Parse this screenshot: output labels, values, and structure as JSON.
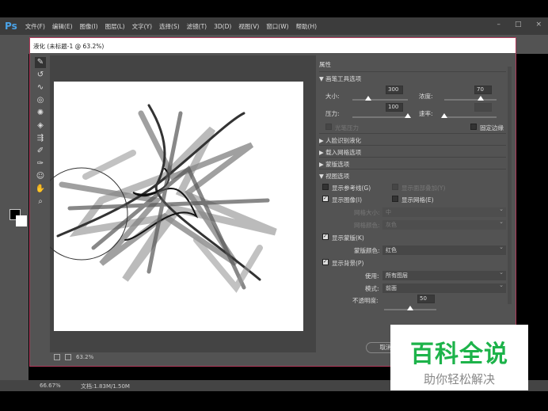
{
  "app": {
    "logo": "Ps",
    "menus": [
      "文件(F)",
      "编辑(E)",
      "图像(I)",
      "图层(L)",
      "文字(Y)",
      "选择(S)",
      "滤镜(T)",
      "3D(D)",
      "视图(V)",
      "窗口(W)",
      "帮助(H)"
    ],
    "window_controls": [
      "–",
      "□",
      "×"
    ]
  },
  "status": {
    "zoom": "66.67%",
    "doc": "文档:1.83M/1.50M"
  },
  "dialog": {
    "title": "液化 (未标题-1 @ 63.2%)",
    "zoom": "63.2%",
    "cancel_label": "取消"
  },
  "panel": {
    "title": "属性",
    "brush_section": "画笔工具选项",
    "size_label": "大小:",
    "size_value": "300",
    "size_fraction": 0.28,
    "density_label": "浓度:",
    "density_value": "70",
    "density_fraction": 0.7,
    "pressure_label": "压力:",
    "pressure_value": "100",
    "pressure_fraction": 1.0,
    "rate_label": "速率:",
    "rate_fraction": 0.0,
    "stylus_label": "光笔压力",
    "pin_edges_label": "固定边缘",
    "face_section": "人脸识别液化",
    "mesh_section": "载入网格选项",
    "mask_section": "蒙版选项",
    "view_section": "视图选项",
    "show_guides": "显示参考线(G)",
    "show_face_overlay": "显示面部叠加(Y)",
    "show_image": "显示图像(I)",
    "show_mesh": "显示网格(E)",
    "mesh_size_label": "网格大小:",
    "mesh_size_value": "中",
    "mesh_color_label": "网格颜色:",
    "mesh_color_value": "灰色",
    "show_mask": "显示蒙版(K)",
    "mask_color_label": "蒙版颜色:",
    "mask_color_value": "红色",
    "show_backdrop": "显示背景(P)",
    "use_label": "使用:",
    "use_value": "所有图层",
    "mode_label": "模式:",
    "mode_value": "前面",
    "opacity_label": "不透明度:",
    "opacity_value": "50",
    "opacity_fraction": 0.5
  },
  "watermark": {
    "title": "百科全说",
    "subtitle": "助你轻松解决"
  }
}
